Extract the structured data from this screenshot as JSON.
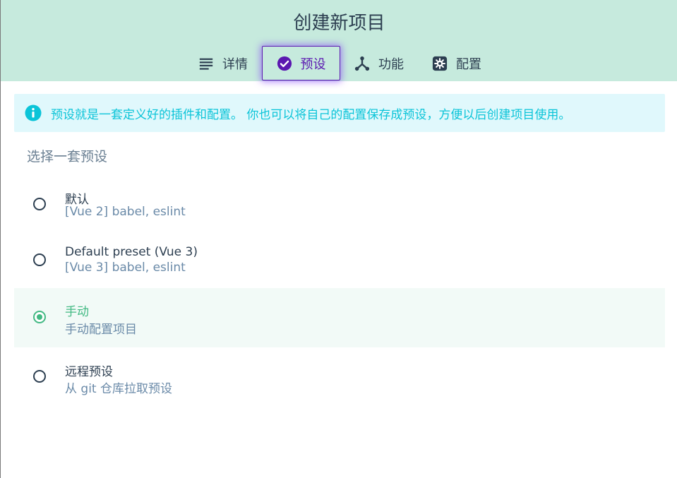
{
  "window": {
    "title": "创建新项目"
  },
  "tabs": [
    {
      "label": "详情",
      "icon": "list-icon",
      "active": false
    },
    {
      "label": "预设",
      "icon": "check-circle-icon",
      "active": true
    },
    {
      "label": "功能",
      "icon": "merge-icon",
      "active": false
    },
    {
      "label": "配置",
      "icon": "gear-icon",
      "active": false
    }
  ],
  "info": {
    "icon": "info-icon",
    "text": "预设就是一套定义好的插件和配置。 你也可以将自己的配置保存成预设，方便以后创建项目使用。"
  },
  "presets": {
    "section_title": "选择一套预设",
    "options": [
      {
        "name": "默认",
        "description": "[Vue 2] babel, eslint",
        "selected": false
      },
      {
        "name": "Default preset (Vue 3)",
        "description": "[Vue 3] babel, eslint",
        "selected": false
      },
      {
        "name": "手动",
        "description": "手动配置项目",
        "selected": true
      },
      {
        "name": "远程预设",
        "description": "从 git 仓库拉取预设",
        "selected": false
      }
    ]
  },
  "colors": {
    "header_bg": "#c6eadd",
    "accent_purple": "#5b18b0",
    "accent_green": "#42b983",
    "info_bg": "#e0f8fc",
    "info_text": "#0bc4d8"
  }
}
